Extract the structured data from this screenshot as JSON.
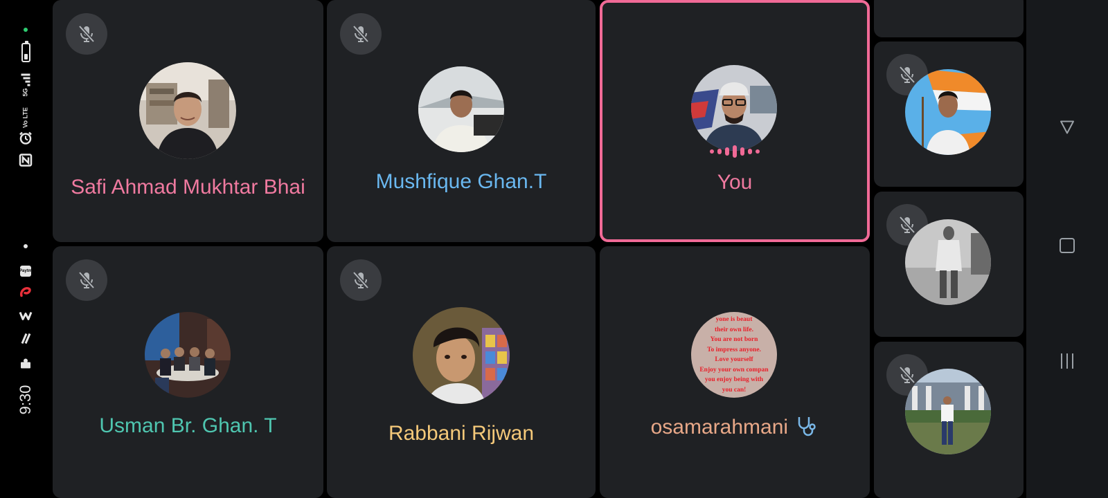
{
  "status_bar": {
    "time": "9:30",
    "network": "5G",
    "volte": "Vo LTE",
    "paytm": "Paytm"
  },
  "participants": [
    {
      "name": "Safi Ahmad Mukhtar Bhai",
      "name_color": "#f07aa0",
      "muted": true
    },
    {
      "name": "Mushfique Ghan.T",
      "name_color": "#6ab8f0",
      "muted": true
    },
    {
      "name": "You",
      "name_color": "#f07aa0",
      "muted": false,
      "speaking": true,
      "is_self": true
    },
    {
      "name": "Usman Br. Ghan. T",
      "name_color": "#4fc6b0",
      "muted": true
    },
    {
      "name": "Rabbani Rijwan",
      "name_color": "#f5c97a",
      "muted": true
    },
    {
      "name": "osamarahmani",
      "name_color": "#e8a888",
      "muted": false,
      "name_icon": "stethoscope-icon"
    }
  ],
  "side_participants": [
    {
      "muted": true
    },
    {
      "muted": true
    },
    {
      "muted": true
    }
  ],
  "osama_avatar_text": [
    "yone is beaut",
    "their own life.",
    "You are not born",
    "To impress anyone.",
    "Love yourself",
    "Enjoy your own compan",
    "you enjoy being with",
    "you can!"
  ],
  "nav": {
    "back": "back-icon",
    "home": "home-icon",
    "recents": "recents-icon"
  }
}
